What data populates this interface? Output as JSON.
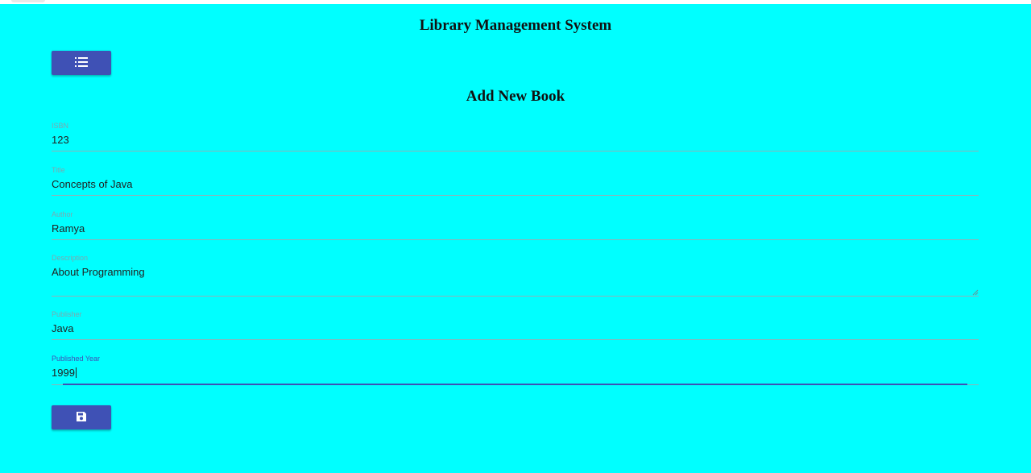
{
  "app": {
    "title": "Library Management System"
  },
  "toolbar": {
    "list_icon": "list-icon"
  },
  "form": {
    "heading": "Add New Book",
    "fields": [
      {
        "label": "ISBN",
        "value": "123"
      },
      {
        "label": "Title",
        "value": "Concepts of Java"
      },
      {
        "label": "Author",
        "value": "Ramya"
      },
      {
        "label": "Description",
        "value": "About Programming"
      },
      {
        "label": "Publisher",
        "value": "Java"
      },
      {
        "label": "Published Year",
        "value": "1999"
      }
    ],
    "save_icon": "save-icon"
  },
  "colors": {
    "background": "#00ffff",
    "accent": "#3f51b5"
  }
}
